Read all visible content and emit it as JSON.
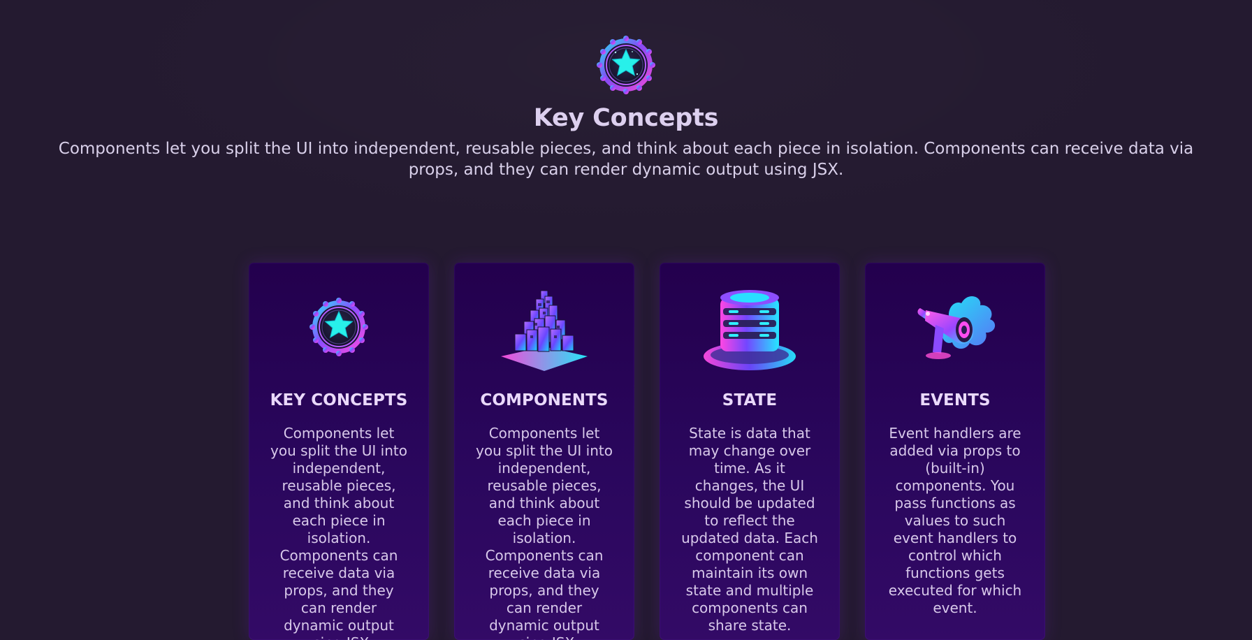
{
  "header": {
    "title": "Key Concepts",
    "description": "Components let you split the UI into independent, reusable pieces, and think about each piece in isolation. Components can receive data via props, and they can render dynamic output using JSX.",
    "icon": "star-badge-icon"
  },
  "cards": [
    {
      "title": "KEY CONCEPTS",
      "text": "Components let you split the UI into independent, reusable pieces, and think about each piece in isolation. Components can receive data via props, and they can render dynamic output using JSX.",
      "icon": "star-badge-icon"
    },
    {
      "title": "COMPONENTS",
      "text": "Components let you split the UI into independent, reusable pieces, and think about each piece in isolation. Components can receive data via props, and they can render dynamic output using JSX.",
      "icon": "blocks-tower-icon"
    },
    {
      "title": "STATE",
      "text": "State is data that may change over time. As it changes, the UI should be updated to reflect the updated data. Each component can maintain its own state and multiple components can share state.",
      "icon": "database-icon"
    },
    {
      "title": "EVENTS",
      "text": "Event handlers are added via props to (built-in) components. You pass functions as values to such event handlers to control which functions gets executed for which event.",
      "icon": "megaphone-icon"
    }
  ],
  "colors": {
    "background": "#241a30",
    "card": "#2a075d",
    "accent_cyan": "#19e8ea",
    "accent_purple": "#9b43ff",
    "accent_pink": "#ff4fd6"
  }
}
